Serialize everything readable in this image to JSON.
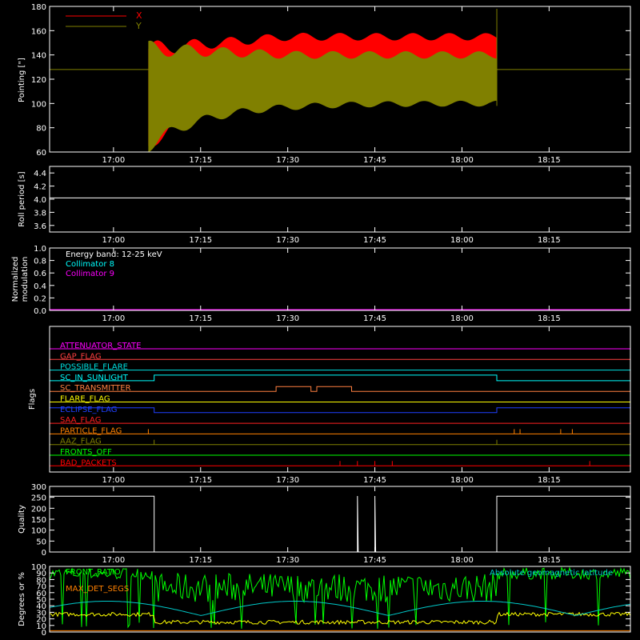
{
  "time_ticks": [
    "17:00",
    "17:15",
    "17:30",
    "17:45",
    "18:00",
    "18:15"
  ],
  "colors": {
    "frame": "#ffffff",
    "x_series": "#ff0000",
    "y_series": "#808000",
    "roll": "#ffffff",
    "collimator8": "#00ffff",
    "collimator9": "#ff00ff",
    "quality": "#ffffff",
    "front_ratio": "#00ff00",
    "yellow_series": "#ffff00",
    "orange_series": "#ff8000",
    "geomag": "#00c8c8"
  },
  "chart_data": [
    {
      "type": "area",
      "panel": "pointing",
      "ylabel": "Pointing [\"]",
      "ylim": [
        60,
        180
      ],
      "yticks": [
        "60",
        "80",
        "100",
        "120",
        "140",
        "160",
        "180"
      ],
      "legend": [
        "X",
        "Y"
      ],
      "start": "17:06",
      "end": "18:06",
      "x_band": {
        "upper_start": 145,
        "upper_end": 155,
        "lower_start": 65,
        "lower_end": 110
      },
      "y_band": {
        "upper_start": 145,
        "upper_end": 140,
        "lower_start": 65,
        "lower_end": 100
      },
      "reference_line": 128,
      "series": [
        {
          "name": "X"
        },
        {
          "name": "Y"
        }
      ]
    },
    {
      "type": "line",
      "panel": "roll",
      "ylabel": "Roll period [s]",
      "ylim": [
        3.5,
        4.5
      ],
      "yticks": [
        "3.6",
        "3.8",
        "4.0",
        "4.2",
        "4.4"
      ],
      "value": 4.02
    },
    {
      "type": "line",
      "panel": "modulation",
      "ylabel_line1": "Normalized",
      "ylabel_line2": "modulation",
      "ylim": [
        0,
        1
      ],
      "yticks": [
        "0.0",
        "0.2",
        "0.4",
        "0.6",
        "0.8",
        "1.0"
      ],
      "legend": [
        "Energy band: 12-25 keV",
        "Collimator 8",
        "Collimator 9"
      ],
      "value": 0.0
    },
    {
      "type": "table",
      "panel": "flags",
      "ylabel": "Flags",
      "flags": [
        {
          "name": "ATTENUATOR_STATE",
          "color": "#ff00ff"
        },
        {
          "name": "GAP_FLAG",
          "color": "#ff4040"
        },
        {
          "name": "POSSIBLE_FLARE",
          "color": "#00e0e0"
        },
        {
          "name": "SC_IN_SUNLIGHT",
          "color": "#00ffff"
        },
        {
          "name": "SC_TRANSMITTER",
          "color": "#ff8040"
        },
        {
          "name": "FLARE_FLAG",
          "color": "#ffff00"
        },
        {
          "name": "ECLIPSE_FLAG",
          "color": "#2040ff"
        },
        {
          "name": "SAA_FLAG",
          "color": "#ff2020"
        },
        {
          "name": "PARTICLE_FLAG",
          "color": "#ff8000"
        },
        {
          "name": "AAZ_FLAG",
          "color": "#808000"
        },
        {
          "name": "FRONTS_OFF",
          "color": "#00ff00"
        },
        {
          "name": "BAD_PACKETS",
          "color": "#ff0000"
        }
      ]
    },
    {
      "type": "line",
      "panel": "quality",
      "ylabel": "Quality",
      "ylim": [
        0,
        300
      ],
      "yticks": [
        "0",
        "50",
        "100",
        "150",
        "200",
        "250",
        "300"
      ],
      "value": 255
    },
    {
      "type": "line",
      "panel": "ratios",
      "ylabel": "Degrees or %",
      "ylim": [
        0,
        100
      ],
      "yticks": [
        "0",
        "10",
        "20",
        "30",
        "40",
        "50",
        "60",
        "70",
        "80",
        "90",
        "100"
      ],
      "legend": [
        "FRONT_RATIO",
        "",
        "MAX_DET_SEGS"
      ],
      "annotation": "Absolute geomagnetic latitude"
    }
  ]
}
